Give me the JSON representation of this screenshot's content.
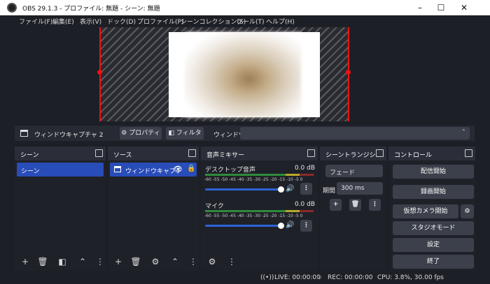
{
  "titlebar": {
    "title": "OBS 29.1.3 - プロファイル: 無題 - シーン: 無題",
    "min": "–",
    "max": "☐",
    "close": "✕"
  },
  "menu": [
    "ファイル(F)",
    "編集(E)",
    "表示(V)",
    "ドック(D)",
    "プロファイル(P)",
    "シーンコレクション(S)",
    "ツール(T)",
    "ヘルプ(H)"
  ],
  "sourcebar": {
    "name": "ウィンドウキャプチャ 2",
    "properties": "プロパティ",
    "filters": "フィルタ",
    "window_label": "ウィンドウ"
  },
  "docks": {
    "scenes": {
      "title": "シーン",
      "items": [
        "シーン"
      ]
    },
    "sources": {
      "title": "ソース",
      "items": [
        "ウィンドウキャプチ"
      ]
    },
    "mixer": {
      "title": "音声ミキサー",
      "channels": [
        {
          "name": "デスクトップ音声",
          "level": "0.0 dB",
          "volume": 0.82
        },
        {
          "name": "マイク",
          "level": "0.0 dB",
          "volume": 0.82
        }
      ],
      "scale": "-60 -55 -50 -45 -40 -35 -30 -25 -20 -15 -10 -5 0"
    },
    "transitions": {
      "title": "シーントランジシ…",
      "type": "フェード",
      "duration_label": "期間",
      "duration": "300 ms"
    },
    "controls": {
      "title": "コントロール",
      "buttons": [
        "配信開始",
        "録画開始",
        "仮想カメラ開始",
        "スタジオモード",
        "設定",
        "終了"
      ]
    }
  },
  "status": {
    "live": "LIVE: 00:00:00",
    "rec": "REC: 00:00:00",
    "cpu": "CPU: 3.8%, 30.00 fps"
  },
  "colors": {
    "accent": "#284cb8",
    "record_red": "#e11111",
    "bg": "#1d1f26"
  }
}
